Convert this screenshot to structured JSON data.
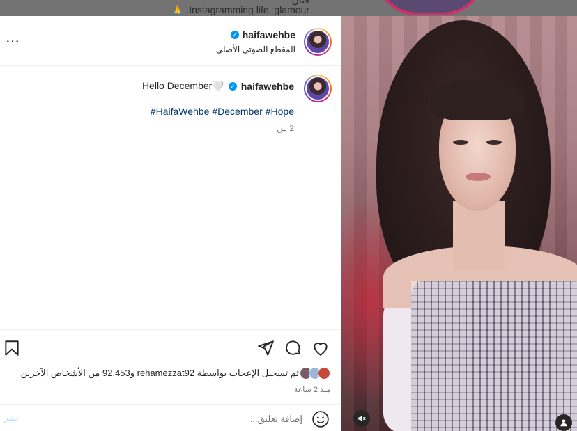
{
  "background": {
    "bio_line_1": "فنان",
    "bio_line_2": "Instagramming life, glamour. 🙏"
  },
  "post": {
    "username": "haifawehbe",
    "audio_label": "المقطع الصوتي الأصلي",
    "caption_text": "Hello December🤍",
    "hashtags": [
      "#HaifaWehbe",
      "#December",
      "#Hope"
    ],
    "caption_time": "2 س",
    "likes_text": "تم تسجيل الإعجاب بواسطة rehamezzat92 و92,453 من الأشخاص الآخرين",
    "date_text": "منذ 2 ساعة",
    "comment_placeholder": "إضافة تعليق...",
    "post_button": "نشر",
    "more_icon": "⋯"
  },
  "icons": {
    "like": "heart-icon",
    "comment": "comment-icon",
    "share": "share-icon",
    "save": "bookmark-icon",
    "emoji": "emoji-icon",
    "mute": "muted-speaker-icon",
    "tagged": "user-icon"
  },
  "colors": {
    "verified": "#0095f6",
    "hashtag": "#00376b",
    "post_button_disabled": "#b2dffc"
  }
}
